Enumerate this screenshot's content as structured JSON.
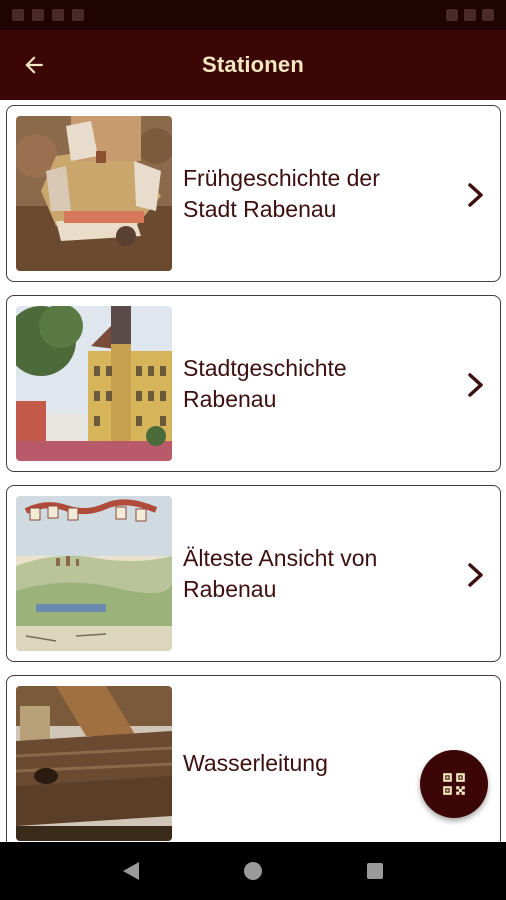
{
  "app_bar": {
    "title": "Stationen",
    "back_icon": "arrow-left-icon"
  },
  "stations": [
    {
      "title": "Frühgeschichte  der\nStadt Rabenau",
      "image": "castle-model-thumbnail"
    },
    {
      "title": "Stadtgeschichte\nRabenau",
      "image": "town-hall-thumbnail"
    },
    {
      "title": "Älteste Ansicht von\nRabenau",
      "image": "historic-panorama-thumbnail"
    },
    {
      "title": "Wasserleitung",
      "image": "wooden-pipe-thumbnail"
    }
  ],
  "fab": {
    "icon": "qr-code-icon"
  },
  "colors": {
    "app_bar": "#3d0606",
    "title_text": "#f3e8c0",
    "card_text": "#3d0f0f",
    "card_border": "#4a3a3a"
  },
  "nav": {
    "back": "nav-back-icon",
    "home": "nav-home-icon",
    "recents": "nav-recents-icon"
  }
}
